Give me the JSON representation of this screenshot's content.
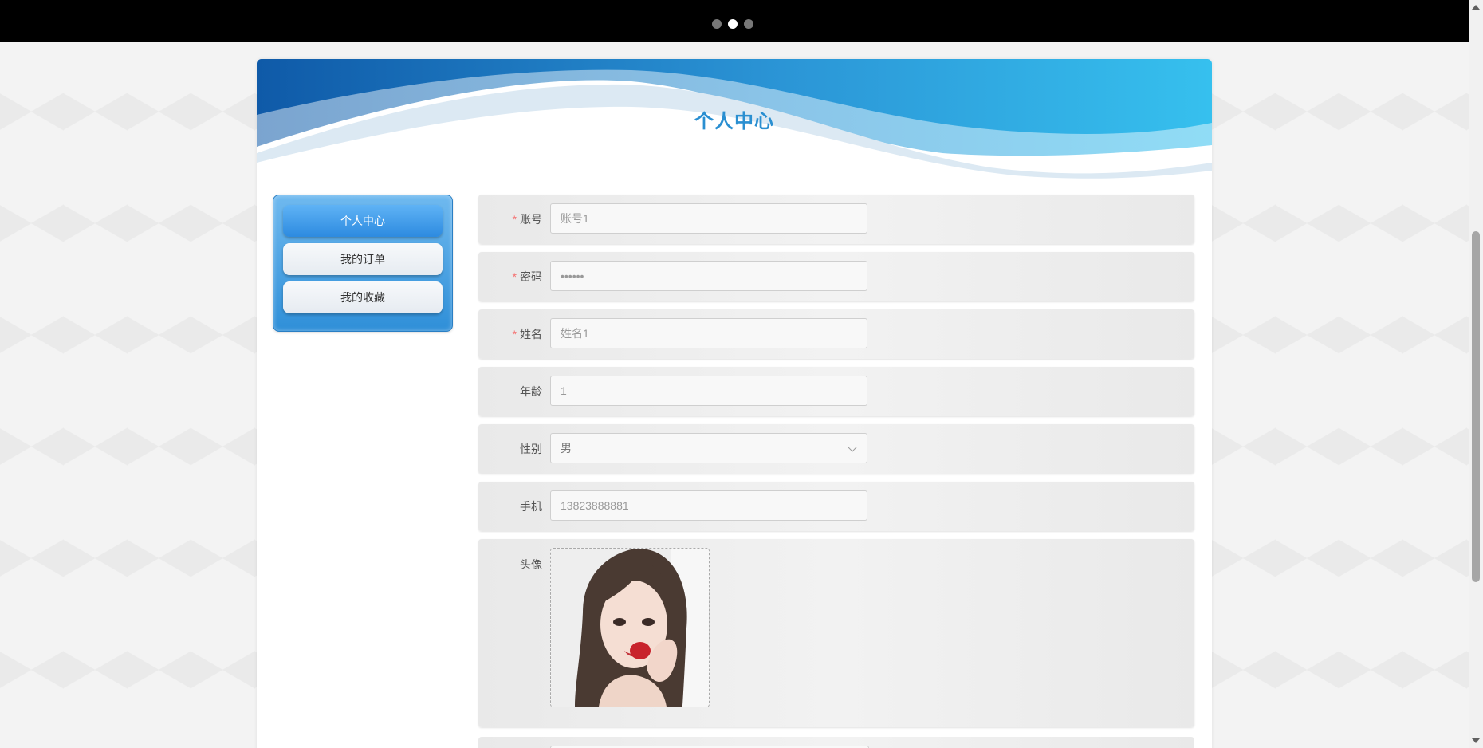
{
  "page": {
    "title": "个人中心"
  },
  "carousel": {
    "dot_count": 3,
    "active_index": 1
  },
  "sidebar": {
    "items": [
      {
        "label": "个人中心",
        "active": true
      },
      {
        "label": "我的订单",
        "active": false
      },
      {
        "label": "我的收藏",
        "active": false
      }
    ]
  },
  "form": {
    "account": {
      "label": "账号",
      "required": true,
      "value": "账号1"
    },
    "password": {
      "label": "密码",
      "required": true,
      "value": "••••••"
    },
    "name": {
      "label": "姓名",
      "required": true,
      "value": "姓名1"
    },
    "age": {
      "label": "年龄",
      "required": false,
      "value": "1"
    },
    "gender": {
      "label": "性别",
      "required": false,
      "value": "男"
    },
    "phone": {
      "label": "手机",
      "required": false,
      "value": "13823888881"
    },
    "avatar": {
      "label": "头像",
      "required": false
    }
  },
  "colors": {
    "accent": "#2a8fd1",
    "required": "#f56c6c",
    "banner": "#000000"
  }
}
